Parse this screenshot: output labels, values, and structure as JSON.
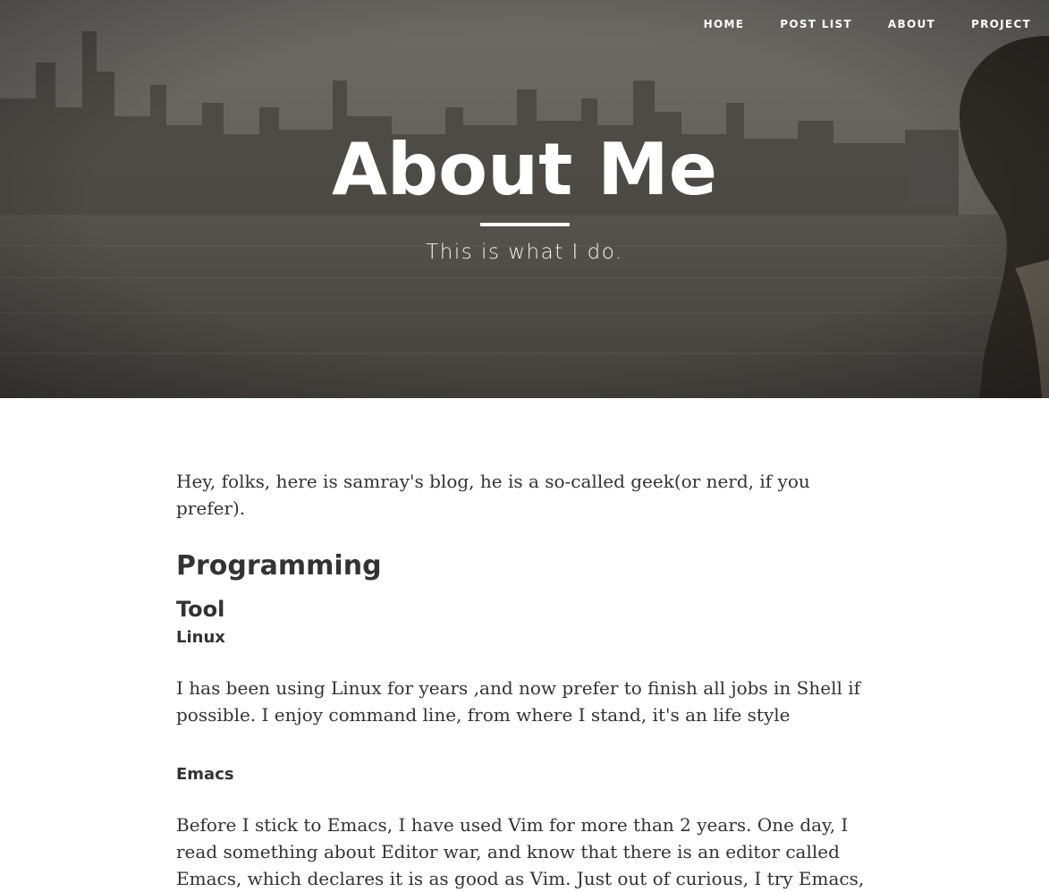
{
  "nav": {
    "items": [
      {
        "label": "HOME"
      },
      {
        "label": "POST LIST"
      },
      {
        "label": "ABOUT"
      },
      {
        "label": "PROJECT"
      }
    ]
  },
  "hero": {
    "title": "About Me",
    "subtitle": "This is what I do.",
    "overlay_color": "#5e5b58"
  },
  "article": {
    "intro": "Hey, folks, here is samray's blog, he is a so-called geek(or nerd, if you prefer).",
    "programming_heading": "Programming",
    "tool_heading": "Tool",
    "linux_heading": "Linux",
    "linux_text": "I has been using Linux for years ,and now prefer to finish all jobs in Shell if possible. I enjoy command line, from where I stand, it's an life style",
    "emacs_heading": "Emacs",
    "emacs_text": "Before I stick to Emacs, I have used Vim for more than 2 years. One day, I read something about Editor war, and know that there is an editor called Emacs, which declares it is as good as Vim. Just out of curious, I try Emacs,"
  },
  "colors": {
    "text": "#333333",
    "nav_text": "#ffffff"
  }
}
